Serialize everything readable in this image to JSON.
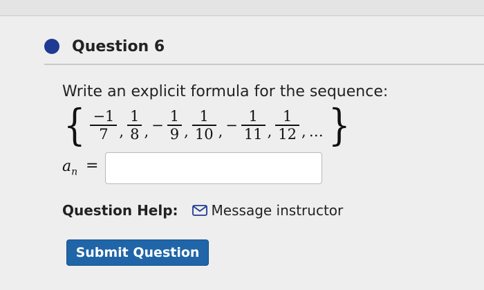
{
  "question": {
    "title": "Question 6",
    "prompt": "Write an explicit formula for the sequence:"
  },
  "sequence": {
    "terms": [
      {
        "sign": "",
        "num": "−1",
        "den": "7"
      },
      {
        "sign": "",
        "num": "1",
        "den": "8"
      },
      {
        "sign": "−",
        "num": "1",
        "den": "9"
      },
      {
        "sign": "",
        "num": "1",
        "den": "10"
      },
      {
        "sign": "−",
        "num": "1",
        "den": "11"
      },
      {
        "sign": "",
        "num": "1",
        "den": "12"
      }
    ],
    "ellipsis": "…",
    "open_brace": "{",
    "close_brace": "}"
  },
  "answer": {
    "variable": "a",
    "subscript": "n",
    "equals": "=",
    "value": ""
  },
  "help": {
    "label": "Question Help:",
    "message_link": "Message instructor"
  },
  "submit_label": "Submit Question",
  "colors": {
    "bullet": "#1f3a93",
    "submit_bg": "#1f65a8"
  }
}
